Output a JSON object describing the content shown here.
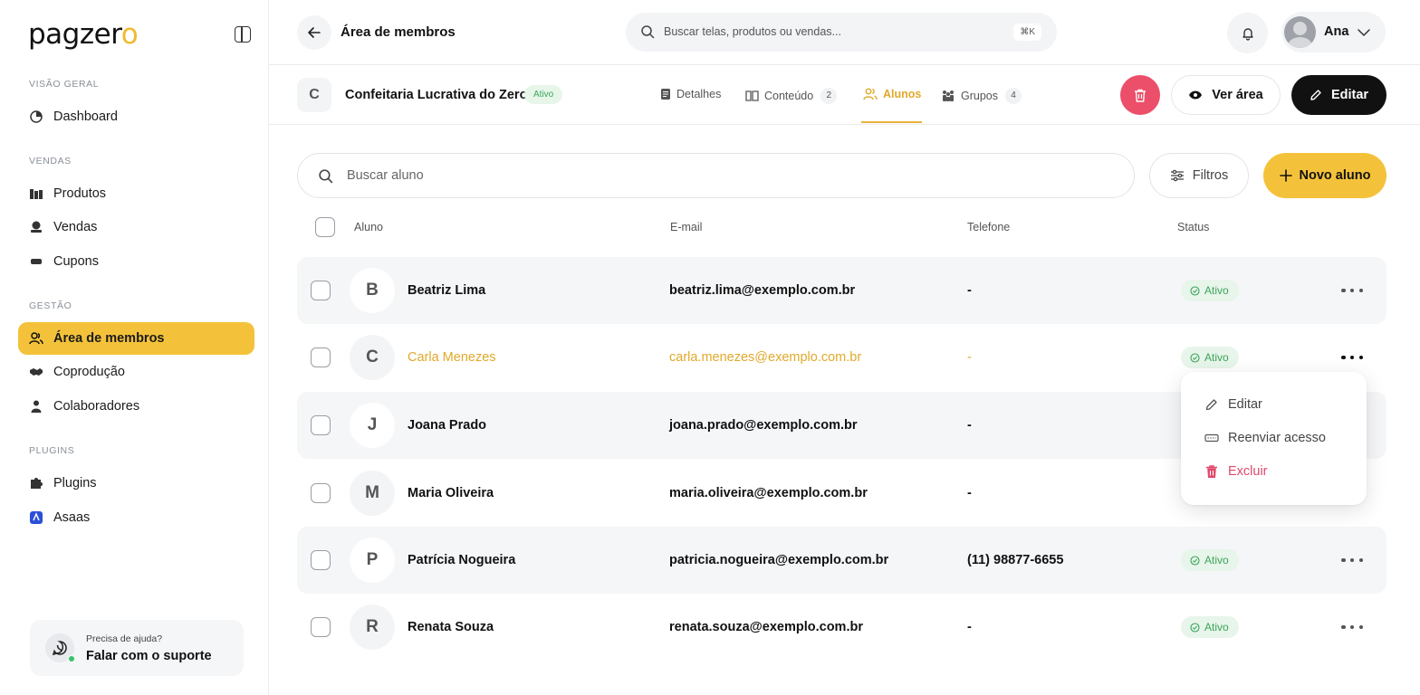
{
  "sidebar": {
    "logo_main": "pagzer",
    "logo_accent": "o",
    "sections": [
      {
        "label": "VISÃO GERAL"
      },
      {
        "label": "VENDAS"
      },
      {
        "label": "GESTÃO"
      },
      {
        "label": "PLUGINS"
      }
    ],
    "items": [
      {
        "label": "Dashboard",
        "icon": "dashboard-icon"
      },
      {
        "label": "Produtos",
        "icon": "products-icon"
      },
      {
        "label": "Vendas",
        "icon": "sales-icon"
      },
      {
        "label": "Cupons",
        "icon": "coupon-icon"
      },
      {
        "label": "Área de membros",
        "icon": "members-icon",
        "active": true
      },
      {
        "label": "Coprodução",
        "icon": "handshake-icon"
      },
      {
        "label": "Colaboradores",
        "icon": "collaborators-icon"
      },
      {
        "label": "Plugins",
        "icon": "puzzle-icon"
      },
      {
        "label": "Asaas",
        "icon": "asaas-icon"
      }
    ],
    "support": {
      "caption": "Precisa de ajuda?",
      "label": "Falar com o suporte"
    }
  },
  "topbar": {
    "title": "Área de membros",
    "search_placeholder": "Buscar telas, produtos ou vendas...",
    "shortcut": "⌘K",
    "user_name": "Ana"
  },
  "course": {
    "initial": "C",
    "title": "Confeitaria Lucrativa do Zero",
    "status": "Ativo",
    "tabs": [
      {
        "label": "Detalhes",
        "count": null
      },
      {
        "label": "Conteúdo",
        "count": "2"
      },
      {
        "label": "Alunos",
        "count": null,
        "active": true
      },
      {
        "label": "Grupos",
        "count": "4"
      }
    ],
    "view_label": "Ver área",
    "edit_label": "Editar"
  },
  "toolbar": {
    "search_placeholder": "Buscar aluno",
    "filters_label": "Filtros",
    "new_label": "Novo aluno"
  },
  "table": {
    "headers": [
      "Aluno",
      "E-mail",
      "Telefone",
      "Status"
    ],
    "rows": [
      {
        "initial": "B",
        "name": "Beatriz Lima",
        "email": "beatriz.lima@exemplo.com.br",
        "phone": "-",
        "status": "Ativo"
      },
      {
        "initial": "C",
        "name": "Carla Menezes",
        "email": "carla.menezes@exemplo.com.br",
        "phone": "-",
        "status": "Ativo"
      },
      {
        "initial": "J",
        "name": "Joana Prado",
        "email": "joana.prado@exemplo.com.br",
        "phone": "-",
        "status": ""
      },
      {
        "initial": "M",
        "name": "Maria Oliveira",
        "email": "maria.oliveira@exemplo.com.br",
        "phone": "-",
        "status": ""
      },
      {
        "initial": "P",
        "name": "Patrícia Nogueira",
        "email": "patricia.nogueira@exemplo.com.br",
        "phone": "(11) 98877-6655",
        "status": "Ativo"
      },
      {
        "initial": "R",
        "name": "Renata Souza",
        "email": "renata.souza@exemplo.com.br",
        "phone": "-",
        "status": "Ativo"
      }
    ]
  },
  "row_menu": {
    "items": [
      {
        "label": "Editar",
        "icon": "pencil-icon"
      },
      {
        "label": "Reenviar acesso",
        "icon": "resend-icon"
      },
      {
        "label": "Excluir",
        "icon": "trash-icon"
      }
    ]
  },
  "colors": {
    "accent": "#f4c23a",
    "danger": "#ec4f6a",
    "success": "#3ba45a"
  }
}
